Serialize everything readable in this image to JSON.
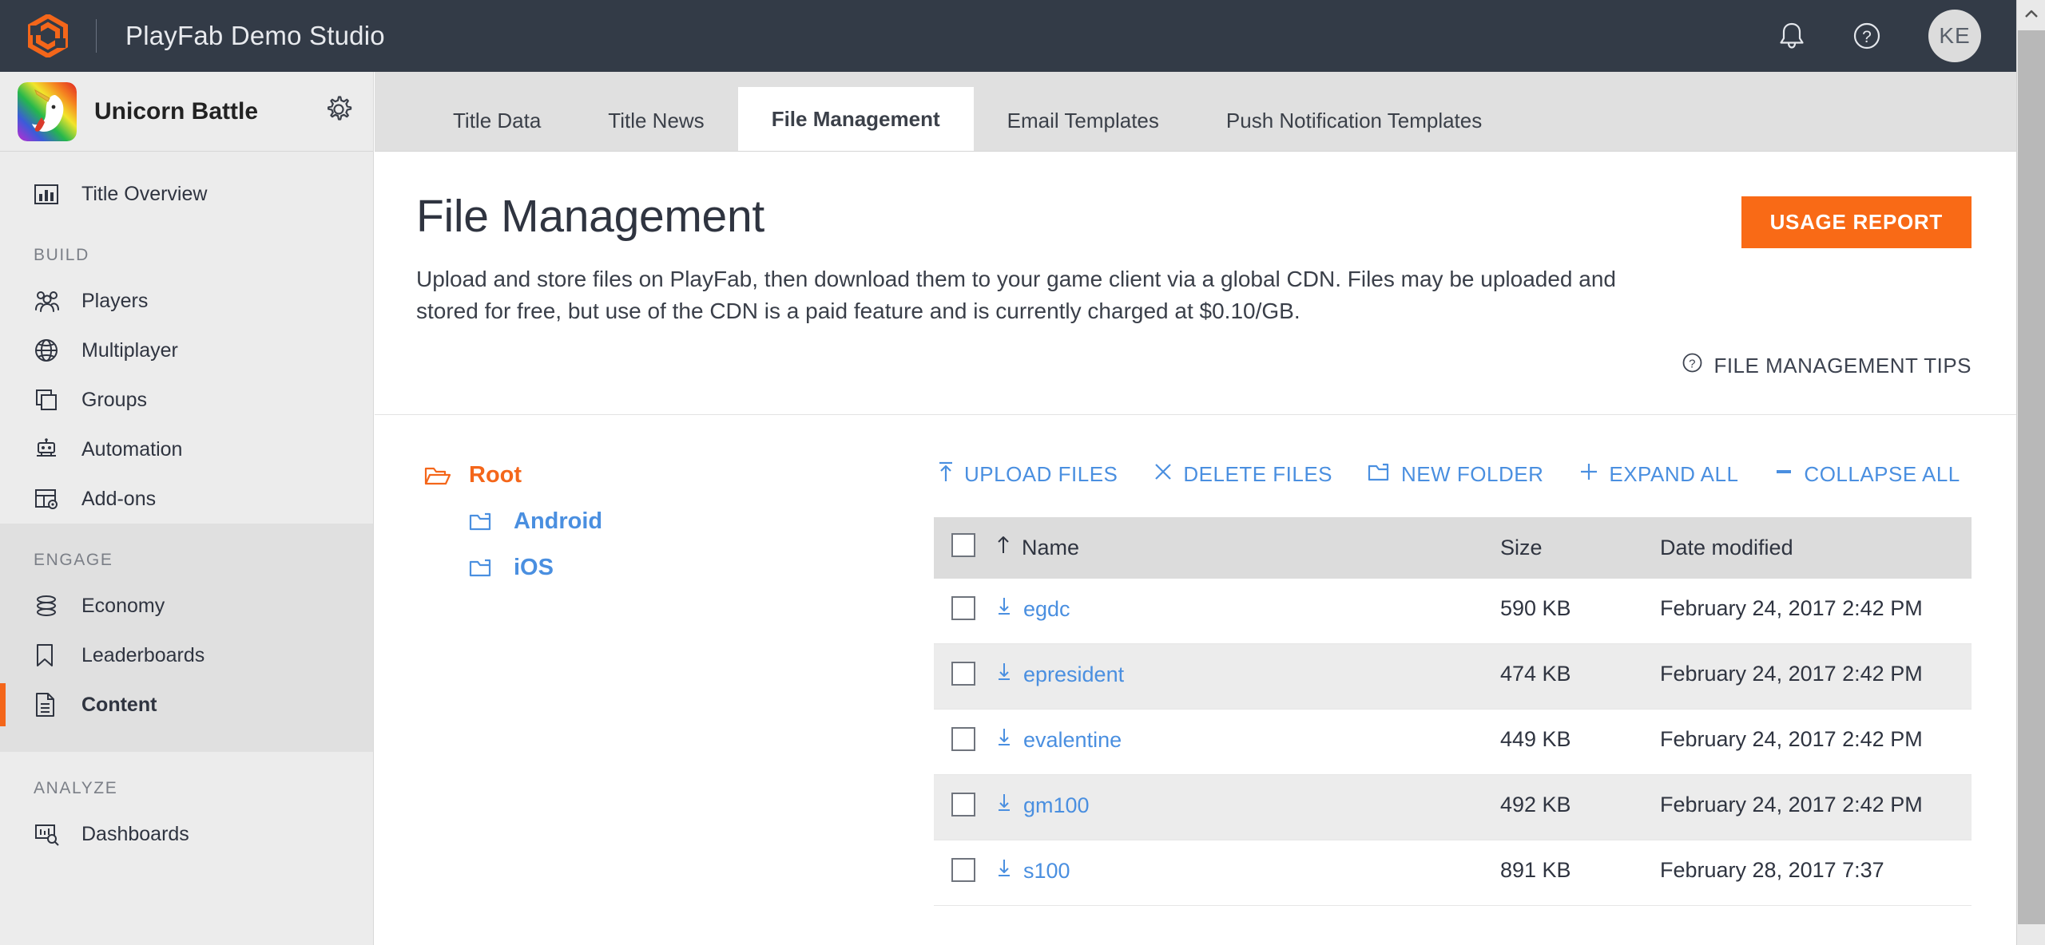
{
  "topbar": {
    "logo_icon": "playfab-hexagon-logo",
    "app_title": "PlayFab Demo Studio",
    "notifications_icon": "bell-icon",
    "help_icon": "help-circle-icon",
    "avatar_initials": "KE"
  },
  "sidebar": {
    "title_name": "Unicorn Battle",
    "title_thumb_icon": "unicorn-battle-thumbnail",
    "settings_icon": "gear-icon",
    "overview": {
      "label": "Title Overview",
      "icon": "bar-chart-icon"
    },
    "sections": [
      {
        "heading": "BUILD",
        "shaded": false,
        "items": [
          {
            "label": "Players",
            "icon": "people-icon",
            "active": false
          },
          {
            "label": "Multiplayer",
            "icon": "globe-icon",
            "active": false
          },
          {
            "label": "Groups",
            "icon": "stacked-squares-icon",
            "active": false
          },
          {
            "label": "Automation",
            "icon": "robot-icon",
            "active": false
          },
          {
            "label": "Add-ons",
            "icon": "addons-grid-icon",
            "active": false
          }
        ]
      },
      {
        "heading": "ENGAGE",
        "shaded": true,
        "items": [
          {
            "label": "Economy",
            "icon": "coins-stack-icon",
            "active": false
          },
          {
            "label": "Leaderboards",
            "icon": "bookmark-icon",
            "active": false
          },
          {
            "label": "Content",
            "icon": "document-icon",
            "active": true
          }
        ]
      },
      {
        "heading": "ANALYZE",
        "shaded": false,
        "items": [
          {
            "label": "Dashboards",
            "icon": "dashboard-search-icon",
            "active": false
          }
        ]
      }
    ]
  },
  "tabs": [
    {
      "label": "Title Data",
      "active": false
    },
    {
      "label": "Title News",
      "active": false
    },
    {
      "label": "File Management",
      "active": true
    },
    {
      "label": "Email Templates",
      "active": false
    },
    {
      "label": "Push Notification Templates",
      "active": false
    }
  ],
  "page": {
    "title": "File Management",
    "description": "Upload and store files on PlayFab, then download them to your game client via a global CDN. Files may be uploaded and stored for free, but use of the CDN is a paid feature and is currently charged at $0.10/GB.",
    "usage_report_label": "USAGE REPORT",
    "tips_label": "FILE MANAGEMENT TIPS",
    "tips_icon": "help-circle-icon"
  },
  "tree": [
    {
      "label": "Root",
      "icon": "folder-open-icon",
      "level": 0,
      "color": "#f4661a"
    },
    {
      "label": "Android",
      "icon": "folder-closed-icon",
      "level": 1,
      "color": "#4a8fe0"
    },
    {
      "label": "iOS",
      "icon": "folder-closed-icon",
      "level": 1,
      "color": "#4a8fe0"
    }
  ],
  "toolbar": [
    {
      "label": "UPLOAD FILES",
      "icon": "upload-arrow-icon"
    },
    {
      "label": "DELETE FILES",
      "icon": "x-close-icon"
    },
    {
      "label": "NEW FOLDER",
      "icon": "new-folder-icon"
    },
    {
      "label": "EXPAND ALL",
      "icon": "plus-icon"
    },
    {
      "label": "COLLAPSE ALL",
      "icon": "minus-icon"
    }
  ],
  "table": {
    "headers": {
      "name": "Name",
      "size": "Size",
      "date": "Date modified"
    },
    "sort_icon": "sort-ascending-arrow-icon",
    "row_download_icon": "download-arrow-icon",
    "rows": [
      {
        "name": "egdc",
        "size": "590 KB",
        "date": "February 24, 2017 2:42 PM"
      },
      {
        "name": "epresident",
        "size": "474 KB",
        "date": "February 24, 2017 2:42 PM"
      },
      {
        "name": "evalentine",
        "size": "449 KB",
        "date": "February 24, 2017 2:42 PM"
      },
      {
        "name": "gm100",
        "size": "492 KB",
        "date": "February 24, 2017 2:42 PM"
      },
      {
        "name": "s100",
        "size": "891 KB",
        "date": "February 28, 2017 7:37"
      }
    ]
  },
  "scrollbar": {
    "up_icon": "chevron-up-icon"
  },
  "colors": {
    "header_bg": "#333b47",
    "brand_orange": "#f4661a",
    "link_blue": "#4a8fe0",
    "sidebar_bg": "#ececec",
    "table_header_bg": "#dcdcdc"
  }
}
